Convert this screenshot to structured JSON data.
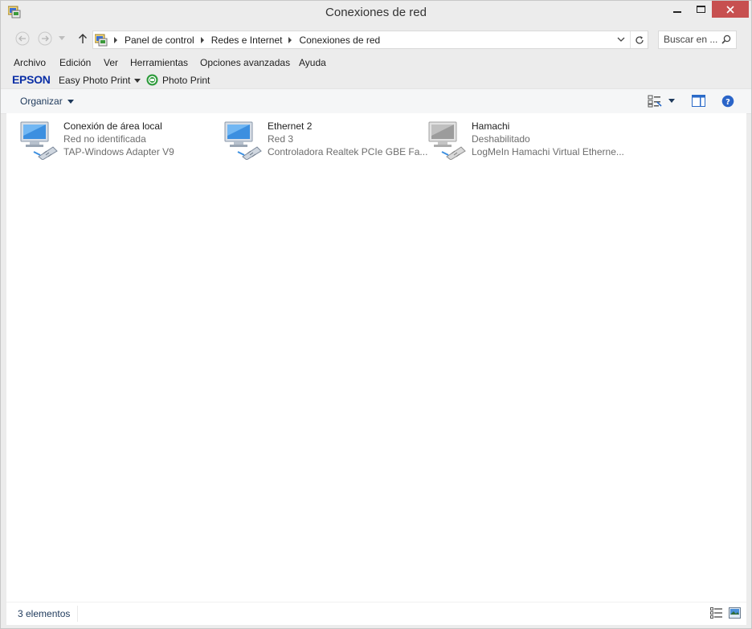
{
  "window": {
    "title": "Conexiones de red",
    "icon": "network-connections-icon",
    "controls": [
      "minimize-icon",
      "maximize-icon",
      "close-icon"
    ]
  },
  "addressbar": {
    "breadcrumbs": [
      "Panel de control",
      "Redes e Internet",
      "Conexiones de red"
    ]
  },
  "search": {
    "placeholder": "Buscar en ..."
  },
  "menu": [
    "Archivo",
    "Edición",
    "Ver",
    "Herramientas",
    "Opciones avanzadas",
    "Ayuda"
  ],
  "epson": {
    "logo": "EPSON",
    "easy_photo_print": "Easy Photo Print",
    "photo_print": "Photo Print"
  },
  "commandbar": {
    "organize": "Organizar"
  },
  "connections": [
    {
      "name": "Conexión de área local",
      "status": "Red no identificada",
      "adapter": "TAP-Windows Adapter V9",
      "state": "enabled"
    },
    {
      "name": "Ethernet 2",
      "status": "Red  3",
      "adapter": "Controladora Realtek PCIe GBE Fa...",
      "state": "enabled"
    },
    {
      "name": "Hamachi",
      "status": "Deshabilitado",
      "adapter": "LogMeIn Hamachi Virtual Etherne...",
      "state": "disabled"
    }
  ],
  "statusbar": {
    "count": "3 elementos"
  },
  "colors": {
    "close_button": "#c75050",
    "link_text": "#1e395b",
    "epson_blue": "#0b2fa6",
    "secondary_text": "#6d6d6d"
  }
}
